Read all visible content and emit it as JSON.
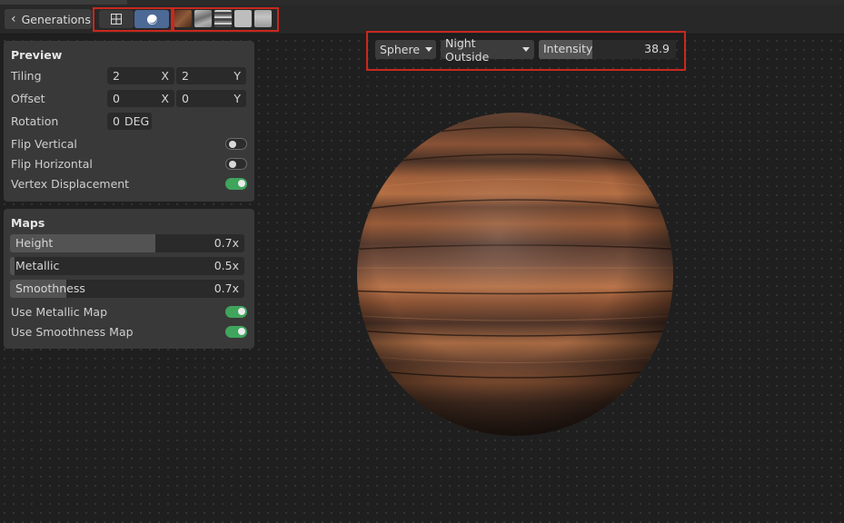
{
  "toolbar": {
    "back_label": "Generations",
    "view_modes": [
      "grid-view-icon",
      "sphere-view-icon"
    ],
    "active_view": "sphere",
    "map_thumbnails": [
      {
        "name": "albedo-thumbnail",
        "color": "#7a4a30"
      },
      {
        "name": "normal-thumbnail",
        "color": "#9a9a9a"
      },
      {
        "name": "height-thumbnail",
        "color": "#7d7d7d"
      },
      {
        "name": "metallic-thumbnail",
        "color": "#b8b8b8"
      },
      {
        "name": "smoothness-thumbnail",
        "color": "#a8a8a8"
      }
    ]
  },
  "preview": {
    "title": "Preview",
    "tiling_label": "Tiling",
    "tiling_x": "2",
    "tiling_y": "2",
    "offset_label": "Offset",
    "offset_x": "0",
    "offset_y": "0",
    "axis_x": "X",
    "axis_y": "Y",
    "rotation_label": "Rotation",
    "rotation_value": "0",
    "rotation_unit": "DEG",
    "flip_vertical_label": "Flip Vertical",
    "flip_vertical": false,
    "flip_horizontal_label": "Flip Horizontal",
    "flip_horizontal": false,
    "vertex_displacement_label": "Vertex Displacement",
    "vertex_displacement": true
  },
  "maps": {
    "title": "Maps",
    "height_label": "Height",
    "height_value": "0.7x",
    "height_fill": 0.62,
    "metallic_label": "Metallic",
    "metallic_value": "0.5x",
    "metallic_fill": 0.02,
    "smoothness_label": "Smoothness",
    "smoothness_value": "0.7x",
    "smoothness_fill": 0.24,
    "use_metallic_label": "Use Metallic Map",
    "use_metallic": true,
    "use_smoothness_label": "Use Smoothness Map",
    "use_smoothness": true
  },
  "viewport": {
    "shape": "Sphere",
    "environment": "Night Outside",
    "intensity_label": "Intensity",
    "intensity_value": "38.9",
    "intensity_fill": 0.39
  },
  "colors": {
    "accent_blue": "#4d6a96",
    "toggle_on": "#3fa55c",
    "highlight_red": "#c8281f"
  }
}
